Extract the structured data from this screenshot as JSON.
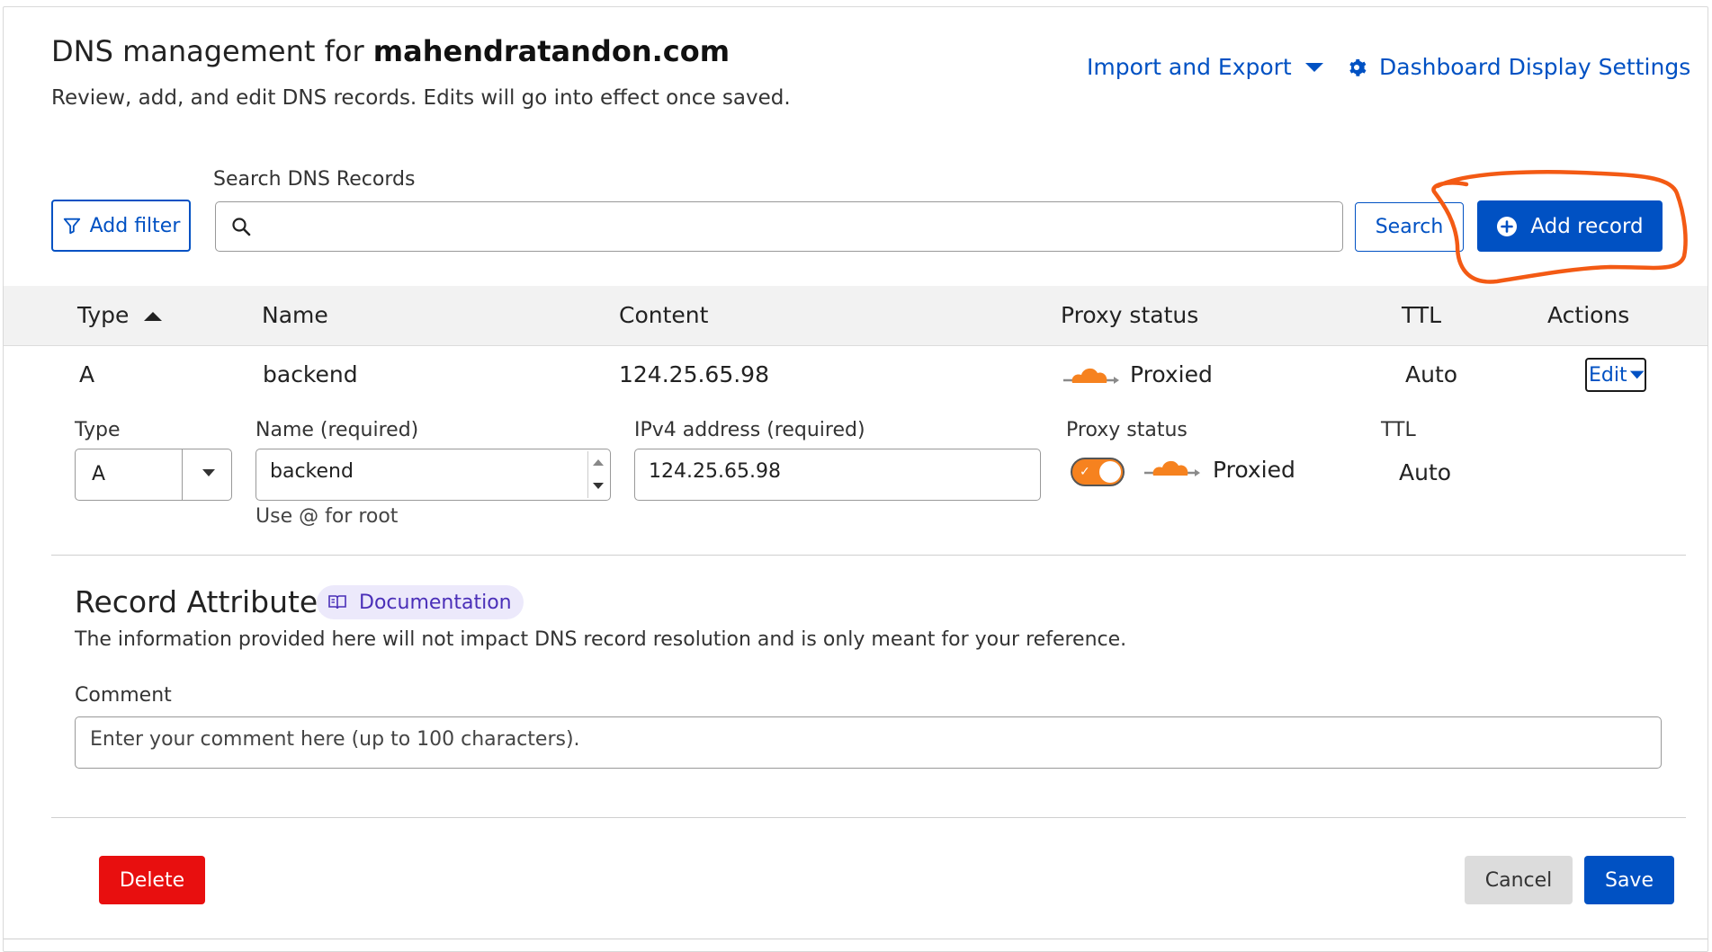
{
  "header": {
    "title_prefix": "DNS management for ",
    "domain": "mahendratandon.com",
    "subtitle": "Review, add, and edit DNS records. Edits will go into effect once saved.",
    "import_export_label": "Import and Export",
    "dashboard_settings_label": "Dashboard Display Settings"
  },
  "toolbar": {
    "add_filter_label": "Add filter",
    "search_label": "Search DNS Records",
    "search_value": "",
    "search_button_label": "Search",
    "add_record_label": "Add record"
  },
  "table": {
    "columns": [
      "Type",
      "Name",
      "Content",
      "Proxy status",
      "TTL",
      "Actions"
    ],
    "rows": [
      {
        "type": "A",
        "name": "backend",
        "content": "124.25.65.98",
        "proxy_status": "Proxied",
        "ttl": "Auto",
        "action_label": "Edit"
      }
    ]
  },
  "edit_form": {
    "type_label": "Type",
    "type_value": "A",
    "name_label": "Name (required)",
    "name_value": "backend",
    "name_hint": "Use @ for root",
    "ip_label": "IPv4 address (required)",
    "ip_value": "124.25.65.98",
    "proxy_label": "Proxy status",
    "proxy_value": "Proxied",
    "proxy_enabled": true,
    "ttl_label": "TTL",
    "ttl_value": "Auto"
  },
  "attributes": {
    "title": "Record Attributes",
    "doc_label": "Documentation",
    "description": "The information provided here will not impact DNS record resolution and is only meant for your reference.",
    "comment_label": "Comment",
    "comment_placeholder": "Enter your comment here (up to 100 characters).",
    "comment_value": ""
  },
  "footer": {
    "delete_label": "Delete",
    "cancel_label": "Cancel",
    "save_label": "Save"
  },
  "colors": {
    "primary": "#0051c3",
    "danger": "#e80f0f",
    "proxy_orange": "#f6821f",
    "annotation_orange": "#f35a14",
    "doc_badge_bg": "#ece9fb"
  },
  "icons": {
    "import_export": "caret-down-icon",
    "dashboard_settings": "gear-icon",
    "add_filter": "filter-icon",
    "search": "search-icon",
    "add_record": "plus-circle-icon",
    "sort": "sort-asc-icon",
    "proxied": "cloud-icon",
    "documentation": "book-icon"
  }
}
